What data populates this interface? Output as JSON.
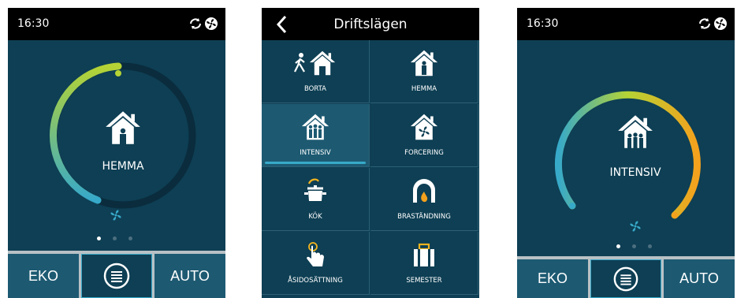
{
  "left_screen": {
    "time": "16:30",
    "mode_label": "HEMMA",
    "pager": {
      "count": 3,
      "active": 1
    },
    "buttons": {
      "left": "EKO",
      "right": "AUTO"
    }
  },
  "middle_screen": {
    "title": "Driftslägen",
    "modes": [
      {
        "label": "BORTA"
      },
      {
        "label": "HEMMA"
      },
      {
        "label": "INTENSIV",
        "selected": true
      },
      {
        "label": "FORCERING"
      },
      {
        "label": "KÖK"
      },
      {
        "label": "BRASTÄNDNING"
      },
      {
        "label": "ÅSIDOSÄTTNING"
      },
      {
        "label": "SEMESTER"
      }
    ]
  },
  "right_screen": {
    "time": "16:30",
    "mode_label": "INTENSIV",
    "pager": {
      "count": 3,
      "active": 1
    },
    "buttons": {
      "left": "EKO",
      "right": "AUTO"
    }
  },
  "colors": {
    "screen_bg": "#0e3f54",
    "button_bg": "#1d5a72",
    "accent": "#37a9c9",
    "gauge_green": "#b5d334",
    "gauge_orange": "#f4a11d"
  },
  "icons": [
    "sync-icon",
    "fan-icon",
    "menu-icon",
    "back-arrow-icon",
    "house-icon"
  ]
}
